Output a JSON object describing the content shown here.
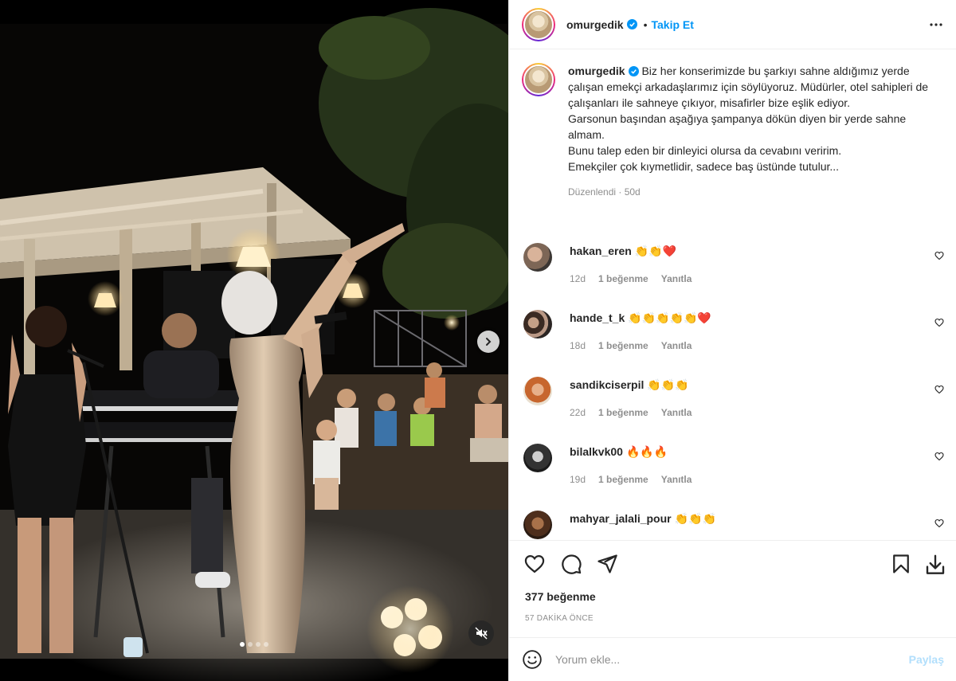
{
  "post": {
    "author": "omurgedik",
    "follow_label": "Takip Et",
    "separator": "•",
    "caption": "Biz her konserimizde bu şarkıyı sahne aldığımız yerde çalışan emekçi arkadaşlarımız için söylüyoruz. Müdürler, otel sahipleri de çalışanları ile sahneye çıkıyor, misafirler bize eşlik ediyor.\nGarsonun başından aşağıya şampanya dökün diyen bir yerde sahne almam.\nBunu talep eden bir dinleyici olursa da cevabını veririm.\nEmekçiler çok kıymetlidir, sadece baş üstünde tutulur...",
    "caption_meta": "Düzenlendi · 50d",
    "likes": "377 beğenme",
    "time": "57 DAKİKA ÖNCE",
    "carousel_count": 4,
    "carousel_active": 0
  },
  "comments": [
    {
      "user": "hakan_eren",
      "text": "👏👏❤️",
      "age": "12d",
      "likes": "1 beğenme",
      "reply": "Yanıtla"
    },
    {
      "user": "hande_t_k",
      "text": "👏👏👏👏👏❤️",
      "age": "18d",
      "likes": "1 beğenme",
      "reply": "Yanıtla"
    },
    {
      "user": "sandikciserpil",
      "text": "👏👏👏",
      "age": "22d",
      "likes": "1 beğenme",
      "reply": "Yanıtla"
    },
    {
      "user": "bilalkvk00",
      "text": "🔥🔥🔥",
      "age": "19d",
      "likes": "1 beğenme",
      "reply": "Yanıtla"
    },
    {
      "user": "mahyar_jalali_pour",
      "text": "👏👏👏",
      "age": "",
      "likes": "",
      "reply": ""
    }
  ],
  "add_comment": {
    "placeholder": "Yorum ekle...",
    "post_label": "Paylaş"
  },
  "icons": {
    "verified": "verified-badge-icon",
    "more": "more-options-icon",
    "like": "heart-icon",
    "comment": "comment-icon",
    "share": "share-icon",
    "save": "bookmark-icon",
    "download": "download-icon",
    "emoji": "emoji-icon",
    "next": "chevron-right-icon",
    "mute": "muted-speaker-icon"
  },
  "colors": {
    "accent": "#0095f6",
    "post_disabled": "#b2dffc",
    "meta": "#8e8e8e",
    "text": "#262626"
  }
}
